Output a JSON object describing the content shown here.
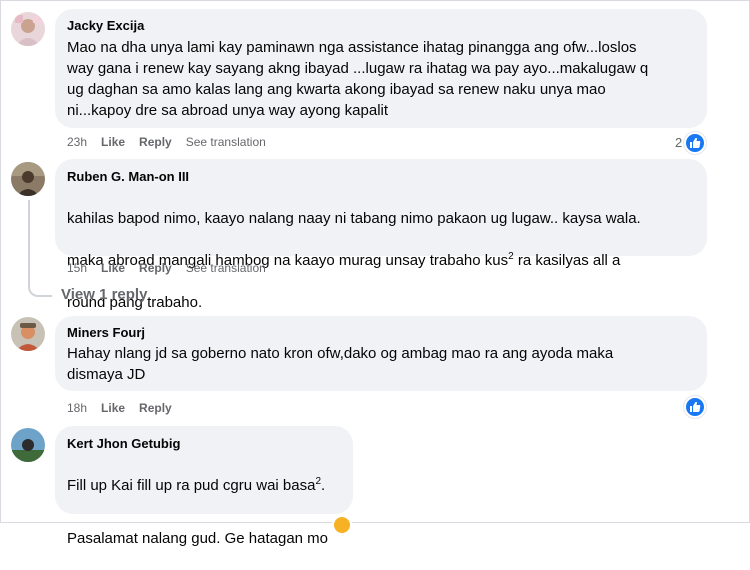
{
  "comments": [
    {
      "author": "Jacky Excija",
      "text": "Mao na dha unya lami kay paminawn nga assistance ihatag pinangga ang ofw...loslos\nway gana i renew kay sayang akng ibayad ...lugaw ra ihatag wa pay ayo...makalugaw q\nug daghan sa amo kalas lang ang kwarta akong ibayad sa renew naku unya mao\nni...kapoy dre sa abroad unya way ayong kapalit",
      "time": "23h",
      "like_label": "Like",
      "reply_label": "Reply",
      "translation_label": "See translation",
      "reaction_count": "2"
    },
    {
      "author": "Ruben G. Man-on III",
      "text_line1": "kahilas bapod nimo, kaayo nalang naay ni tabang nimo pakaon ug lugaw.. kaysa wala.",
      "text_line2_pre": "maka abroad mangali hambog na kaayo murag unsay trabaho kus",
      "text_line2_sup": "2",
      "text_line2_post": " ra kasilyas all a",
      "text_line3": "round pang trabaho.",
      "time": "15h",
      "like_label": "Like",
      "reply_label": "Reply",
      "translation_label": "See translation",
      "view_replies": "View 1 reply"
    },
    {
      "author": "Miners Fourj",
      "text": "Hahay nlang jd sa goberno nato kron ofw,dako og ambag mao ra ang ayoda maka\ndismaya JD",
      "time": "18h",
      "like_label": "Like",
      "reply_label": "Reply"
    },
    {
      "author": "Kert Jhon Getubig",
      "text_line1_pre": "Fill up Kai fill up ra pud cgru wai basa",
      "text_line1_sup": "2",
      "text_line1_post": ".",
      "text_line2": "Pasalamat nalang gud. Ge hatagan mo"
    }
  ],
  "colors": {
    "bubble": "#f0f2f5",
    "meta": "#65676b",
    "like_blue": "#1877f2"
  },
  "icons": [
    "like-reaction-icon",
    "avatar",
    "reply-thread-line"
  ]
}
